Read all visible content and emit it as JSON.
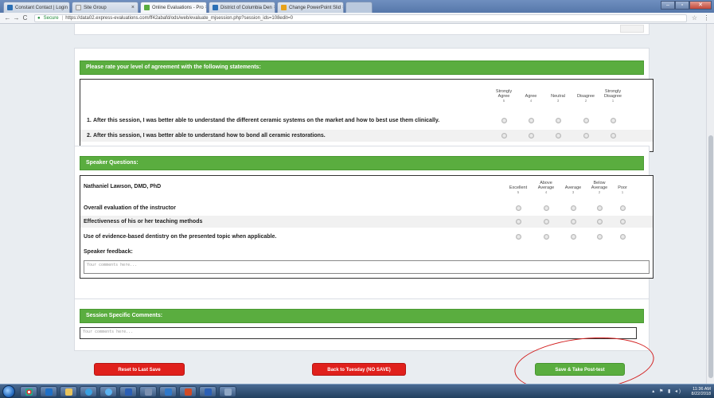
{
  "browser": {
    "tabs": [
      {
        "label": "Constant Contact | Login",
        "color": "#2a6fb5"
      },
      {
        "label": "Site Group",
        "color": "#e5e5e5"
      },
      {
        "label": "Online Evaluations - Pro",
        "color": "#5aad3f",
        "active": true
      },
      {
        "label": "District of Columbia Den",
        "color": "#2a6fb5"
      },
      {
        "label": "Change PowerPoint Slid",
        "color": "#e7a21b"
      }
    ],
    "url": "https://data02.express-evaluations.com/ff42abafd/ods/web/evaluate_mjsession.php?session_ids=108edit=0",
    "secure_label": "Secure"
  },
  "agreement": {
    "heading": "Please rate your level of agreement with the following statements:",
    "columns": [
      {
        "label": "Strongly Agree",
        "num": "5"
      },
      {
        "label": "Agree",
        "num": "4"
      },
      {
        "label": "Neutral",
        "num": "3"
      },
      {
        "label": "Disagree",
        "num": "2"
      },
      {
        "label": "Strongly Disagree",
        "num": "1"
      }
    ],
    "questions": [
      {
        "num": "1.",
        "text": "After this session, I was better able to understand the different ceramic systems on the market and how to best use them clinically."
      },
      {
        "num": "2.",
        "text": "After this session, I was better able to understand how to bond all ceramic restorations."
      }
    ]
  },
  "speaker": {
    "heading": "Speaker Questions:",
    "name": "Nathaniel Lawson, DMD, PhD",
    "columns": [
      {
        "label": "Excellent",
        "num": "5"
      },
      {
        "label": "Above Average",
        "num": "4"
      },
      {
        "label": "Average",
        "num": "3"
      },
      {
        "label": "Below Average",
        "num": "2"
      },
      {
        "label": "Poor",
        "num": "1"
      }
    ],
    "questions": [
      {
        "text": "Overall evaluation of the instructor"
      },
      {
        "text": "Effectiveness of his or her teaching methods"
      },
      {
        "text": "Use of evidence-based dentistry on the presented topic when applicable."
      }
    ],
    "feedback_label": "Speaker feedback:",
    "feedback_placeholder": "Your comments here..."
  },
  "session": {
    "heading": "Session Specific Comments:",
    "placeholder": "Your comments here..."
  },
  "buttons": {
    "reset": "Reset to Last Save",
    "back": "Back to Tuesday (NO SAVE)",
    "save": "Save & Take Post-test"
  },
  "taskbar": {
    "clock_time": "11:36 AM",
    "clock_date": "8/22/2018"
  },
  "colors": {
    "accent_green": "#5aad3f",
    "button_red": "#e0201c",
    "annotation_red": "#d21f1f"
  }
}
